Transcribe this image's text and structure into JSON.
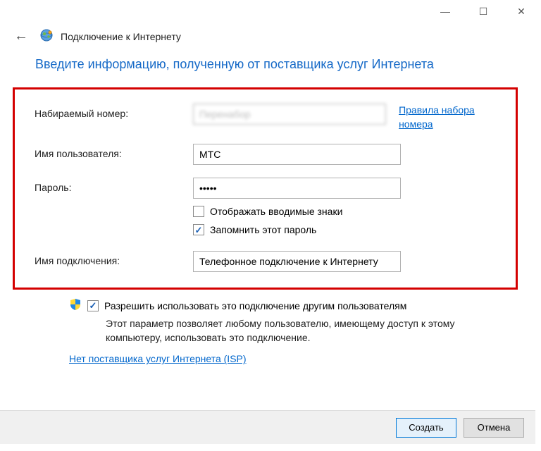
{
  "window": {
    "title": "Подключение к Интернету"
  },
  "heading": "Введите информацию, полученную от поставщика услуг Интернета",
  "form": {
    "dial_number_label": "Набираемый номер:",
    "dial_number_value": "Перенабор",
    "dial_rules_link": "Правила набора номера",
    "username_label": "Имя пользователя:",
    "username_value": "МТС",
    "password_label": "Пароль:",
    "password_value": "•••••",
    "show_chars_label": "Отображать вводимые знаки",
    "show_chars_checked": false,
    "remember_label": "Запомнить этот пароль",
    "remember_checked": true,
    "connection_name_label": "Имя подключения:",
    "connection_name_value": "Телефонное подключение к Интернету"
  },
  "allow": {
    "label": "Разрешить использовать это подключение другим пользователям",
    "checked": true,
    "description": "Этот параметр позволяет любому пользователю, имеющему доступ к этому компьютеру, использовать это подключение."
  },
  "isp_link": "Нет поставщика услуг Интернета (ISP)",
  "buttons": {
    "create": "Создать",
    "cancel": "Отмена"
  }
}
